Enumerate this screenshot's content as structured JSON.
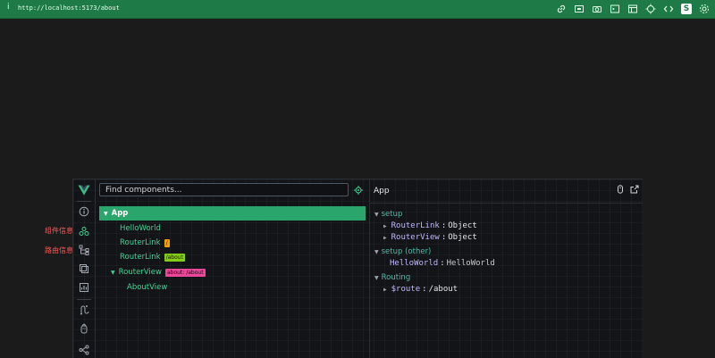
{
  "browser": {
    "url": "http://localhost:5173/about",
    "info_glyph": "i"
  },
  "annotations": {
    "component_info": "组件信息",
    "route_info": "路由信息"
  },
  "tree": {
    "search_placeholder": "Find components...",
    "nodes": [
      {
        "label": "App",
        "selected": true,
        "caret": "▼"
      },
      {
        "label": "HelloWorld"
      },
      {
        "label": "RouterLink",
        "tag": "/"
      },
      {
        "label": "RouterLink",
        "tag": "/about"
      },
      {
        "label": "RouterView",
        "caret": "▼",
        "tag": "about: /about"
      },
      {
        "label": "AboutView"
      }
    ]
  },
  "inspector": {
    "title": "App",
    "sections": [
      {
        "title": "setup",
        "props": [
          {
            "key": "RouterLink",
            "value": "Object"
          },
          {
            "key": "RouterView",
            "value": "Object"
          }
        ]
      },
      {
        "title": "setup (other)",
        "props": [
          {
            "key": "HelloWorld",
            "value": "HelloWorld"
          }
        ]
      },
      {
        "title": "Routing",
        "props": [
          {
            "key": "$route",
            "value": "/about"
          }
        ]
      }
    ],
    "separator": ":"
  },
  "colors": {
    "accent": "#42d392",
    "topbar": "#1e7a46",
    "tag_orange": "#f59e0b",
    "tag_lime": "#84cc16",
    "tag_pink": "#ec4899"
  }
}
